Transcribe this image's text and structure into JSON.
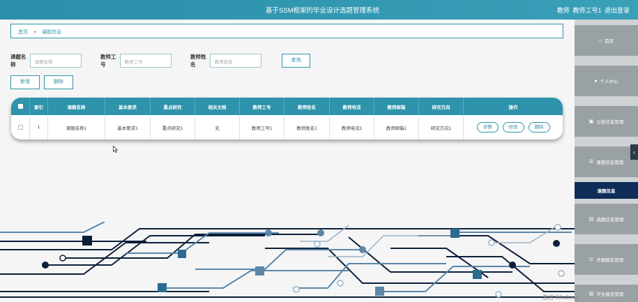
{
  "header": {
    "title": "基于SSM框架的毕业设计选题管理系统",
    "role": "教师",
    "username": "教师工号1",
    "logout": "退出登录"
  },
  "breadcrumb": {
    "home": "首页",
    "separator": "≡",
    "current": "课题信息"
  },
  "search": {
    "fields": [
      {
        "label": "课题名称",
        "placeholder": "课题名称"
      },
      {
        "label": "教师工号",
        "placeholder": "教师工号"
      },
      {
        "label": "教师姓名",
        "placeholder": "教师姓名"
      }
    ],
    "query_label": "查询"
  },
  "actions": {
    "add_label": "新增",
    "delete_label": "删除"
  },
  "table": {
    "columns": [
      "索引",
      "课题名称",
      "基本要求",
      "重点研究",
      "相关文档",
      "教师工号",
      "教师姓名",
      "教师电话",
      "教师邮箱",
      "研究方向",
      "操作"
    ],
    "rows": [
      {
        "index": "1",
        "topic": "课题名称1",
        "requirements": "基本要求1",
        "focus": "重点研究1",
        "docs": "无",
        "teacher_id": "教师工号1",
        "teacher_name": "教师姓名1",
        "phone": "教师电话1",
        "email": "教师邮箱1",
        "direction": "研究方向1"
      }
    ],
    "row_actions": {
      "detail": "详情",
      "edit": "修改",
      "delete": "删除"
    }
  },
  "sidebar": {
    "items": [
      {
        "label": "首页",
        "icon": "home-icon"
      },
      {
        "label": "个人中心",
        "icon": "user-icon"
      },
      {
        "label": "公告信息管理",
        "icon": "notice-icon"
      },
      {
        "label": "课题信息管理",
        "icon": "sliders-icon"
      },
      {
        "label": "课题信息",
        "icon": "",
        "active": true
      },
      {
        "label": "选题信息管理",
        "icon": "briefcase-icon"
      },
      {
        "label": "开题报告管理",
        "icon": "checkbox-icon"
      },
      {
        "label": "学生报告管理",
        "icon": "doc-icon"
      }
    ]
  },
  "watermark": "激活 Windows",
  "colors": {
    "primary": "#2e93ab",
    "sidebar_active": "#0e2d58",
    "sidebar_item": "#9aa1a5"
  }
}
